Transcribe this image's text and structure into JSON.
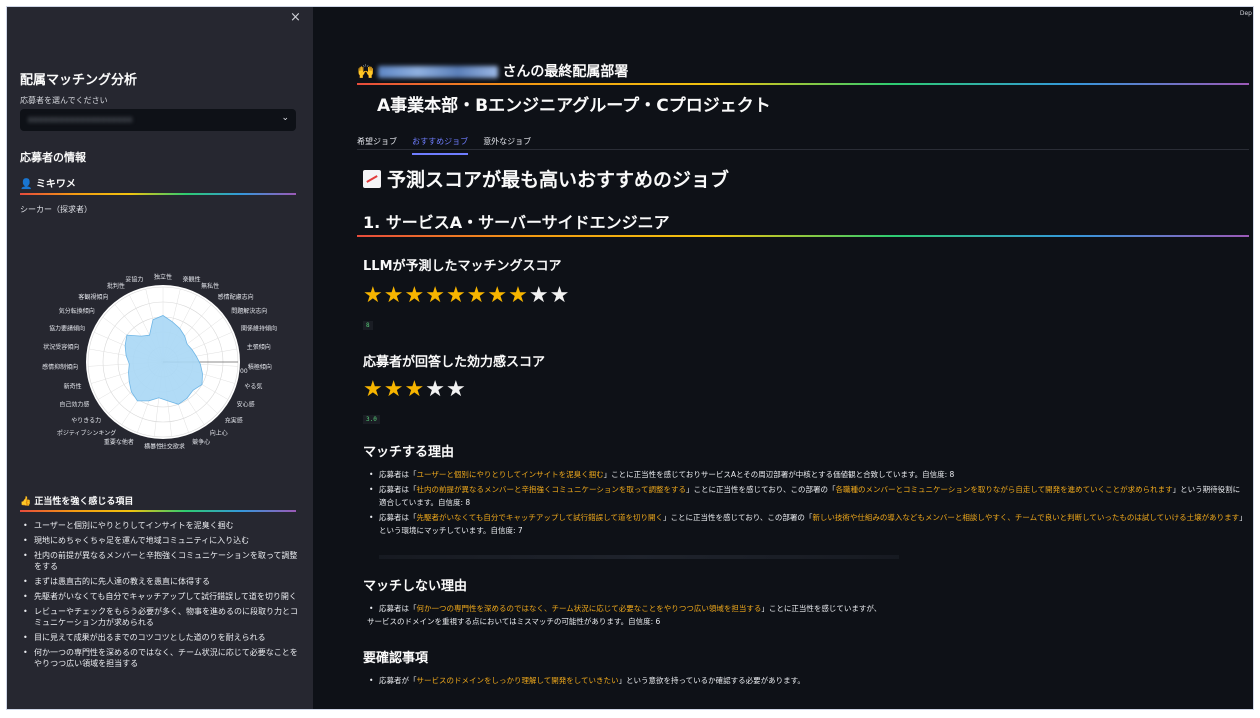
{
  "sidebar": {
    "close_icon": "×",
    "title": "配属マッチング分析",
    "select_label": "応募者を選んでください",
    "select_value": "xxxxxxxxxxxxxxxxxxxx",
    "info_heading": "応募者の情報",
    "applicant_name": "👤 ミキワメ",
    "applicant_type": "シーカー（探求者）",
    "radar": {
      "labels": [
        "独立性",
        "楽観性",
        "無私性",
        "感情配慮志向",
        "問題解決志向",
        "関係維持傾向",
        "主張傾向",
        "積極傾向",
        "やる気",
        "安心感",
        "充実感",
        "向上心",
        "競争心",
        "社交欲求",
        "横暴性",
        "重要な他者",
        "ポジティブシンキング",
        "やりきる力",
        "自己効力感",
        "新奇性",
        "感情抑制傾向",
        "状況受容傾向",
        "協力要請傾向",
        "気分転換傾向",
        "客観視傾向",
        "批判性",
        "妥協力"
      ],
      "values": [
        0.62,
        0.55,
        0.5,
        0.45,
        0.4,
        0.42,
        0.45,
        0.5,
        0.55,
        0.6,
        0.55,
        0.58,
        0.6,
        0.52,
        0.48,
        0.55,
        0.62,
        0.58,
        0.52,
        0.48,
        0.45,
        0.5,
        0.55,
        0.6,
        0.45,
        0.4,
        0.58
      ],
      "tick_label": "00"
    },
    "justice_heading": "👍 正当性を強く感じる項目",
    "justice_items": [
      "ユーザーと個別にやりとりしてインサイトを泥臭く掴む",
      "現地にめちゃくちゃ足を運んで地域コミュニティに入り込む",
      "社内の前提が異なるメンバーと辛抱強くコミュニケーションを取って調整をする",
      "まずは愚直古的に先人達の教えを愚直に体得する",
      "先駆者がいなくても自分でキャッチアップして試行錯誤して道を切り開く",
      "レビューやチェックをもらう必要が多く、物事を進めるのに段取り力とコミュニケーション力が求められる",
      "目に見えて成果が出るまでのコツコツとした道のりを耐えられる",
      "何か一つの専門性を深めるのではなく、チーム状況に応じて必要なことをやりつつ広い領域を担当する"
    ]
  },
  "main": {
    "deploy_label": "Dep",
    "person_prefix": "🙌",
    "person_suffix": "さんの最終配属部署",
    "dept": "A事業本部・Bエンジニアグループ・Cプロジェクト",
    "tabs": [
      "希望ジョブ",
      "おすすめジョブ",
      "意外なジョブ"
    ],
    "active_tab": 1,
    "rec_heading": "予測スコアが最も高いおすすめのジョブ",
    "job_title": "1. サービスA・サーバーサイドエンジニア",
    "llm_heading": "LLMが予測したマッチングスコア",
    "llm_stars": 8,
    "llm_stars_max": 10,
    "llm_score": "8",
    "eff_heading": "応募者が回答した効力感スコア",
    "eff_stars": 3,
    "eff_stars_max": 5,
    "eff_score": "3.0",
    "match_heading": "マッチする理由",
    "match_items": [
      {
        "pre": "応募者は「",
        "hl": "ユーザーと個別にやりとりしてインサイトを泥臭く掴む",
        "mid": "」ことに正当性を感じておりサービスAとその周辺部署が中核とする価値観と合致しています。自信度: 8",
        "hl2": "",
        "post": ""
      },
      {
        "pre": "応募者は「",
        "hl": "社内の前提が異なるメンバーと辛抱強くコミュニケーションを取って調整をする",
        "mid": "」ことに正当性を感じており、この部署の「",
        "hl2": "各職種のメンバーとコミュニケーションを取りながら自走して開発を進めていくことが求められます",
        "post": "」という期待役割に適合しています。自信度: 8"
      },
      {
        "pre": "応募者は「",
        "hl": "先駆者がいなくても自分でキャッチアップして試行錯誤して道を切り開く",
        "mid": "」ことに正当性を感じており、この部署の「",
        "hl2": "新しい技術や仕組みの導入などもメンバーと相談しやすく、チームで良いと判断していったものは試していける土壌があります",
        "post": "」という環境にマッチしています。自信度: 7"
      }
    ],
    "mismatch_heading": "マッチしない理由",
    "mismatch_items": [
      {
        "pre": "応募者は「",
        "hl": "何か一つの専門性を深めるのではなく、チーム状況に応じて必要なことをやりつつ広い領域を担当する",
        "mid": "」ことに正当性を感じていますが、",
        "line2": "サービスのドメインを重視する点においてはミスマッチの可能性があります。自信度: 6"
      }
    ],
    "confirm_heading": "要確認事項",
    "confirm_items": [
      {
        "pre": "応募者が「",
        "hl": "サービスのドメインをしっかり理解して開発をしていきたい",
        "post": "」という意欲を持っているか確認する必要があります。"
      }
    ]
  },
  "colors": {
    "bg": "#0e1117",
    "sidebar": "#262730",
    "accent": "#6f7dff",
    "highlight": "#f0a91b",
    "star": "#f7b500"
  }
}
